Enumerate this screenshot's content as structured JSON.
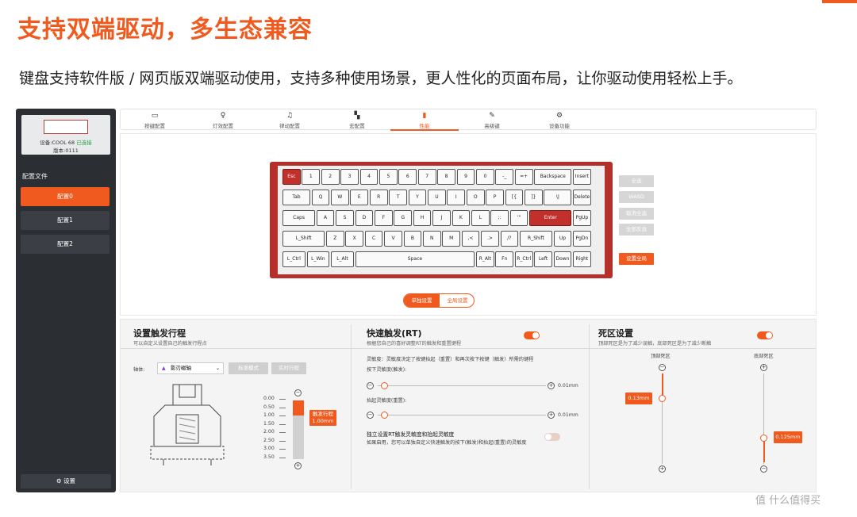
{
  "headline": "支持双端驱动，多生态兼容",
  "subheadline": "键盘支持软件版 / 网页版双端驱动使用，支持多种使用场景，更人性化的页面布局，让你驱动使用轻松上手。",
  "colors": {
    "accent": "#f05a1e",
    "keyboard_frame": "#b5302b",
    "sidebar": "#2b2e33"
  },
  "sidebar": {
    "device_name": "设备:COOL 68",
    "device_status": "已连接",
    "version": "版本:0111",
    "section_label": "配置文件",
    "configs": [
      "配置0",
      "配置1",
      "配置2"
    ],
    "active_config": 0,
    "settings_label": "设置",
    "settings_icon": "gear-icon"
  },
  "tabs": [
    {
      "label": "按键配置",
      "icon": "keyboard-icon"
    },
    {
      "label": "灯效配置",
      "icon": "bulb-icon"
    },
    {
      "label": "律动配置",
      "icon": "music-icon"
    },
    {
      "label": "宏配置",
      "icon": "macro-icon"
    },
    {
      "label": "性能",
      "icon": "chart-icon",
      "active": true
    },
    {
      "label": "高级键",
      "icon": "wrench-icon"
    },
    {
      "label": "设备功能",
      "icon": "gear-icon"
    }
  ],
  "keyboard": {
    "rows": [
      [
        "Esc",
        "1",
        "2",
        "3",
        "4",
        "5",
        "6",
        "7",
        "8",
        "9",
        "0",
        "-_",
        "=+",
        "Backspace",
        "Insert"
      ],
      [
        "Tab",
        "Q",
        "W",
        "E",
        "R",
        "T",
        "Y",
        "U",
        "I",
        "O",
        "P",
        "[{",
        "]}",
        "\\|",
        "Delete"
      ],
      [
        "Caps",
        "A",
        "S",
        "D",
        "F",
        "G",
        "H",
        "J",
        "K",
        "L",
        ";:",
        "'\"",
        "Enter",
        "PgUp"
      ],
      [
        "L_Shift",
        "Z",
        "X",
        "C",
        "V",
        "B",
        "N",
        "M",
        ",<",
        ".>",
        "/?",
        "R_Shift",
        "Up",
        "PgDn"
      ],
      [
        "L_Ctrl",
        "L_Win",
        "L_Alt",
        "Space",
        "R_Alt",
        "Fn",
        "R_Ctrl",
        "Left",
        "Down",
        "Right"
      ]
    ],
    "selected_keys": [
      "Esc",
      "Enter"
    ]
  },
  "quick_select": [
    "全选",
    "WASD",
    "取消全选",
    "全部反选"
  ],
  "set_all_label": "设置全局",
  "mode_toggle": {
    "single": "单独设置",
    "global": "全局设置",
    "active": "single"
  },
  "trigger_travel": {
    "title": "设置触发行程",
    "desc": "可以自定义设置自己的触发行程点",
    "axis_label": "轴体:",
    "axis_value": "影刃磁轴",
    "btn_standard": "标准模式",
    "btn_realtime": "实时行程",
    "scale": [
      "0.00",
      "0.50",
      "1.00",
      "1.50",
      "2.00",
      "2.50",
      "3.00",
      "3.50"
    ],
    "tag_label": "触发行程",
    "tag_value": "1.00mm",
    "fill_fraction": 0.25
  },
  "rapid_trigger": {
    "title": "快速触发(RT)",
    "desc": "根据您自己的喜好调整RT的触发和重置键程",
    "enabled": true,
    "note": "灵敏度：灵敏度决定了按键抬起（重置）和再次按下按键（触发）所需的键程",
    "press_label": "按下灵敏度(触发):",
    "press_value": "0.01mm",
    "release_label": "抬起灵敏度(重置):",
    "release_value": "0.01mm",
    "independent_label": "独立设置RT触发灵敏度和抬起灵敏度",
    "independent_desc": "如果启用，您可以单独自定义快速触发的按下(触发)和抬起(重置)的灵敏度",
    "independent_enabled": false
  },
  "deadzone": {
    "title": "死区设置",
    "desc": "顶部死区是为了减少误触，底部死区是为了减少断触",
    "enabled": true,
    "top_label": "顶部死区",
    "top_value": "0.13mm",
    "bottom_label": "底部死区",
    "bottom_value": "0.125mm"
  },
  "watermark": "值 什么值得买"
}
